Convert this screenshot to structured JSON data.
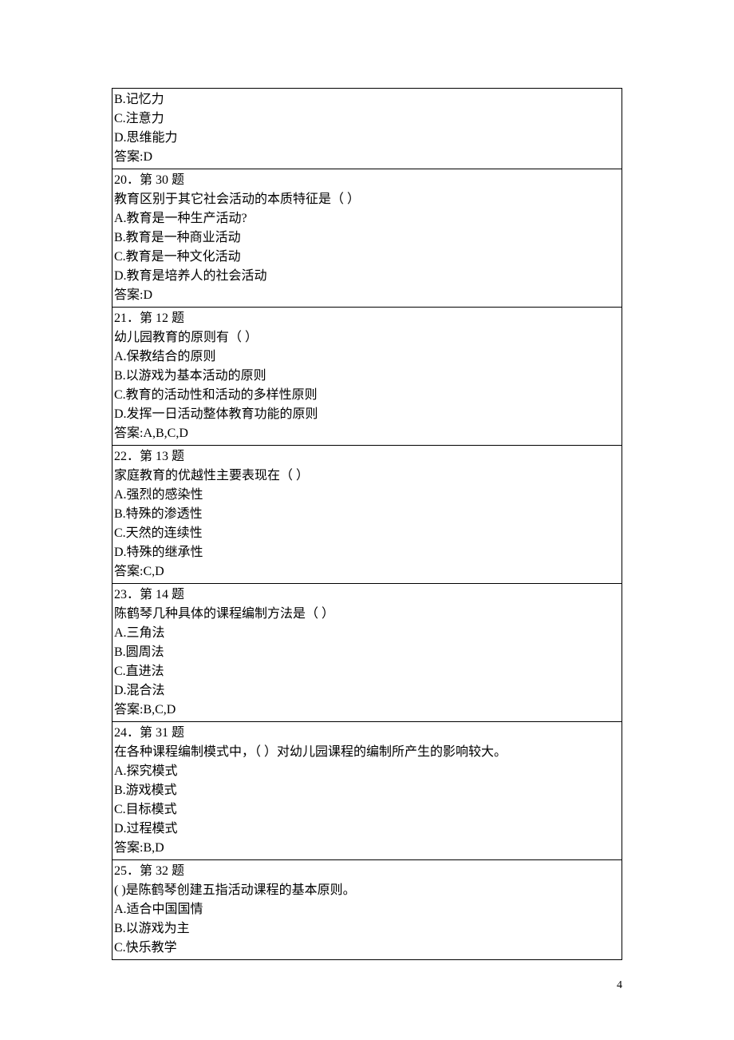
{
  "page_number": "4",
  "cells": [
    {
      "lines": [
        "B.记忆力",
        "C.注意力",
        "D.思维能力",
        "答案:D"
      ]
    },
    {
      "lines": [
        "20．第 30 题",
        "教育区别于其它社会活动的本质特征是（  ）",
        "A.教育是一种生产活动?",
        "B.教育是一种商业活动",
        "C.教育是一种文化活动",
        "D.教育是培养人的社会活动",
        "答案:D"
      ]
    },
    {
      "lines": [
        "21．第 12 题",
        "幼儿园教育的原则有（  ）",
        "A.保教结合的原则",
        "B.以游戏为基本活动的原则",
        "C.教育的活动性和活动的多样性原则",
        "D.发挥一日活动整体教育功能的原则",
        "答案:A,B,C,D"
      ]
    },
    {
      "lines": [
        "22．第 13 题",
        "家庭教育的优越性主要表现在（        ）",
        "A.强烈的感染性",
        "B.特殊的渗透性",
        "C.天然的连续性",
        "D.特殊的继承性",
        "答案:C,D"
      ]
    },
    {
      "lines": [
        "23．第 14 题",
        "陈鹤琴几种具体的课程编制方法是（  ）",
        "A.三角法",
        "B.圆周法",
        "C.直进法",
        "D.混合法",
        "答案:B,C,D"
      ]
    },
    {
      "lines": [
        "24．第 31 题",
        "在各种课程编制模式中，（     ）对幼儿园课程的编制所产生的影响较大。",
        "A.探究模式",
        "B.游戏模式",
        "C.目标模式",
        "D.过程模式",
        "答案:B,D"
      ]
    },
    {
      "lines": [
        "25．第 32 题",
        "( )是陈鹤琴创建五指活动课程的基本原则。",
        "A.适合中国国情",
        "B.以游戏为主",
        "C.快乐教学"
      ]
    }
  ]
}
